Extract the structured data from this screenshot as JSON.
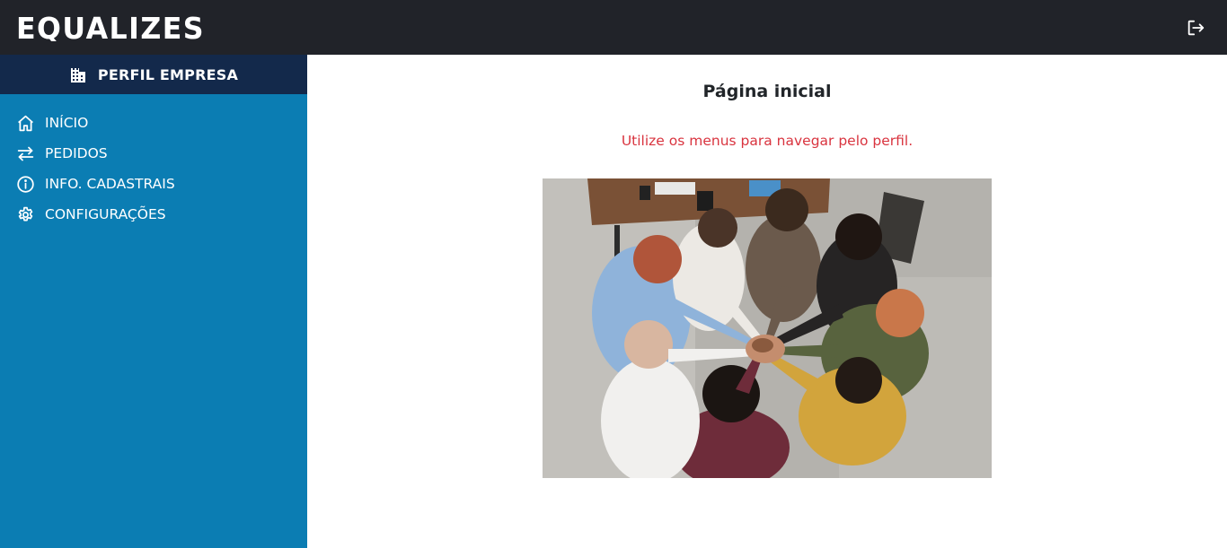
{
  "header": {
    "brand": "EQUALIZES",
    "logout_icon": "logout-icon"
  },
  "sidebar": {
    "title": "PERFIL EMPRESA",
    "title_icon": "building-icon",
    "items": [
      {
        "label": "INÍCIO",
        "icon": "home-icon"
      },
      {
        "label": "PEDIDOS",
        "icon": "arrows-exchange-icon"
      },
      {
        "label": "INFO. CADASTRAIS",
        "icon": "info-circle-icon"
      },
      {
        "label": "CONFIGURAÇÕES",
        "icon": "gear-icon"
      }
    ]
  },
  "main": {
    "title": "Página inicial",
    "subtitle": "Utilize os menus para navegar pelo perfil."
  },
  "colors": {
    "topbar": "#212329",
    "sidebar": "#0b7db3",
    "sidebar_header": "#13294b",
    "subtitle": "#d9343f"
  }
}
